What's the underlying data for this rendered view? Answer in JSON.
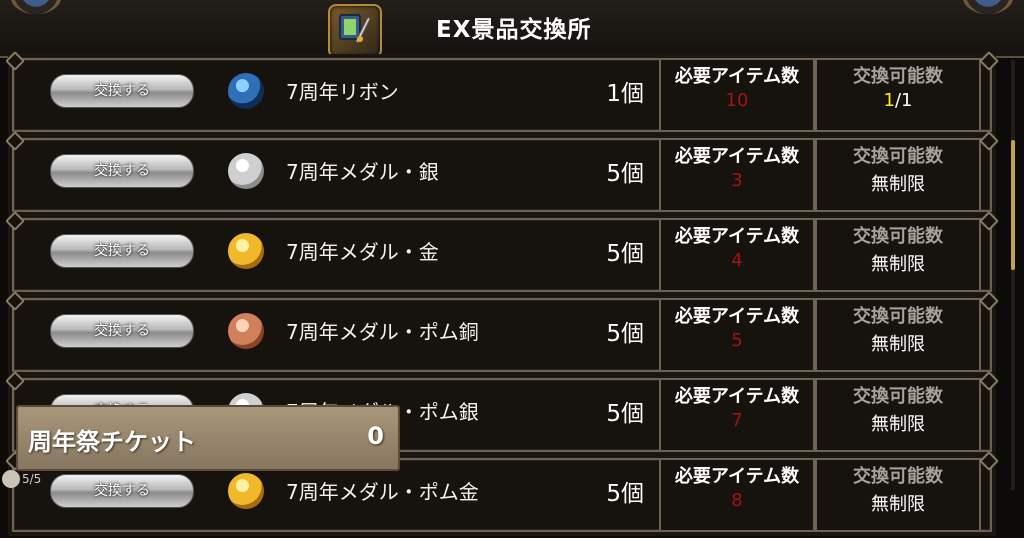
{
  "header": {
    "title": "EX景品交換所",
    "icon": "shop-weapon-icon"
  },
  "labels": {
    "exchange_button": "交換する",
    "required_items": "必要アイテム数",
    "exchangeable": "交換可能数"
  },
  "items": [
    {
      "name": "7周年リボン",
      "qty": "1個",
      "required": "10",
      "avail_current": "1",
      "avail_total": "/1",
      "avail_text": "",
      "icon": "ribbon-icon"
    },
    {
      "name": "7周年メダル・銀",
      "qty": "5個",
      "required": "3",
      "avail_text": "無制限",
      "icon": "silver-medal-icon"
    },
    {
      "name": "7周年メダル・金",
      "qty": "5個",
      "required": "4",
      "avail_text": "無制限",
      "icon": "gold-medal-icon"
    },
    {
      "name": "7周年メダル・ポム銅",
      "qty": "5個",
      "required": "5",
      "avail_text": "無制限",
      "icon": "bronze-pom-medal-icon"
    },
    {
      "name": "7周年メダル・ポム銀",
      "qty": "5個",
      "required": "7",
      "avail_text": "無制限",
      "icon": "silver-pom-medal-icon"
    },
    {
      "name": "7周年メダル・ポム金",
      "qty": "5個",
      "required": "8",
      "avail_text": "無制限",
      "icon": "gold-pom-medal-icon"
    }
  ],
  "ticket": {
    "label": "周年祭チケット",
    "count": "0"
  },
  "footer": {
    "corner_text": "5/5"
  },
  "colors": {
    "required_value": "#a3130f",
    "available_current": "#ffe91a",
    "scroll_thumb": "#c8a24a"
  }
}
